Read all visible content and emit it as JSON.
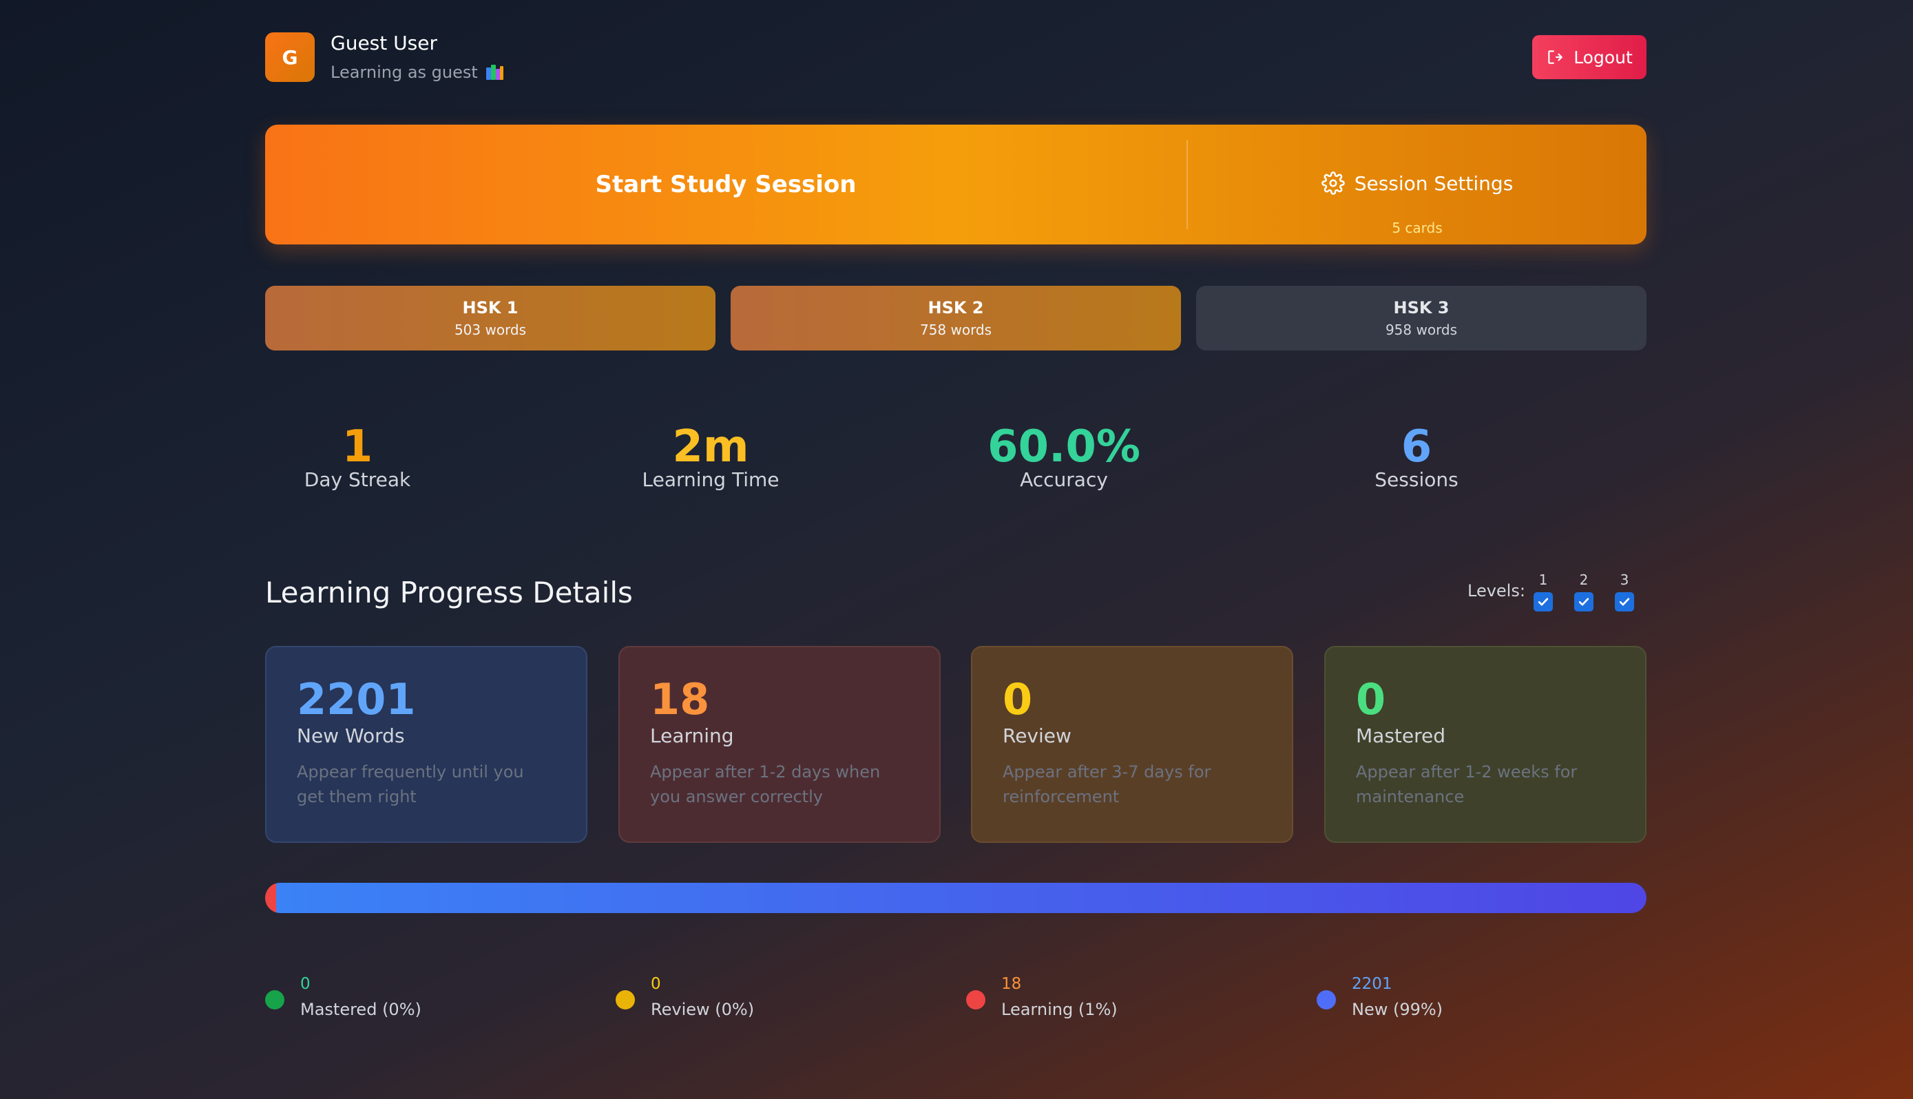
{
  "user": {
    "avatar_initial": "G",
    "name": "Guest User",
    "subtitle": "Learning as guest",
    "subtitle_icon": "books-icon"
  },
  "logout": {
    "label": "Logout",
    "icon": "logout-icon"
  },
  "study": {
    "start_label": "Start Study Session",
    "settings_label": "Session Settings",
    "settings_icon": "gear-icon",
    "cards_label": "5 cards"
  },
  "hsk_levels": [
    {
      "title": "HSK 1",
      "words": "503 words",
      "selected": true
    },
    {
      "title": "HSK 2",
      "words": "758 words",
      "selected": true
    },
    {
      "title": "HSK 3",
      "words": "958 words",
      "selected": false
    }
  ],
  "stats": [
    {
      "value": "1",
      "label": "Day Streak",
      "color": "#f59e0b"
    },
    {
      "value": "2m",
      "label": "Learning Time",
      "color": "#fbbf24"
    },
    {
      "value": "60.0%",
      "label": "Accuracy",
      "color": "#34d399"
    },
    {
      "value": "6",
      "label": "Sessions",
      "color": "#60a5fa"
    }
  ],
  "progress": {
    "title": "Learning Progress Details",
    "levels_label": "Levels:",
    "levels": [
      {
        "num": "1",
        "checked": true
      },
      {
        "num": "2",
        "checked": true
      },
      {
        "num": "3",
        "checked": true
      }
    ]
  },
  "cards": [
    {
      "value": "2201",
      "name": "New Words",
      "desc": "Appear frequently until you get them right",
      "color": "#60a5fa",
      "bg": "#263558",
      "border": "#34466e"
    },
    {
      "value": "18",
      "name": "Learning",
      "desc": "Appear after 1-2 days when you answer correctly",
      "color": "#fb923c",
      "bg": "#4d2c31",
      "border": "#5f3a3c"
    },
    {
      "value": "0",
      "name": "Review",
      "desc": "Appear after 3-7 days for reinforcement",
      "color": "#facc15",
      "bg": "#5a3f27",
      "border": "#6b4c2e"
    },
    {
      "value": "0",
      "name": "Mastered",
      "desc": "Appear after 1-2 weeks for maintenance",
      "color": "#4ade80",
      "bg": "#3f412a",
      "border": "#4e5133"
    }
  ],
  "distribution": {
    "segments": [
      {
        "name": "Mastered",
        "fraction": 0.0,
        "color": "#10b981"
      },
      {
        "name": "Review",
        "fraction": 0.0,
        "color": "#eab308"
      },
      {
        "name": "Learning",
        "fraction": 0.008,
        "color": "#ef4444"
      },
      {
        "name": "New",
        "fraction": 0.992,
        "color": "#4f46e5"
      }
    ]
  },
  "legend": [
    {
      "value": "0",
      "label": "Mastered (0%)",
      "value_color": "#34d399",
      "dot_color": "#16a34a"
    },
    {
      "value": "0",
      "label": "Review (0%)",
      "value_color": "#facc15",
      "dot_color": "#eab308"
    },
    {
      "value": "18",
      "label": "Learning (1%)",
      "value_color": "#fb923c",
      "dot_color": "#ef4444"
    },
    {
      "value": "2201",
      "label": "New (99%)",
      "value_color": "#60a5fa",
      "dot_color": "#4f6ef7"
    }
  ]
}
